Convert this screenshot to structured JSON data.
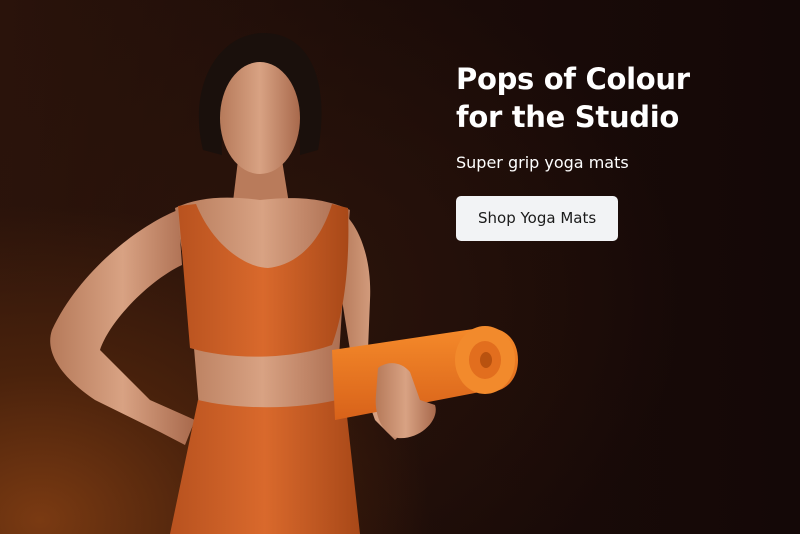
{
  "hero": {
    "headline_line1": "Pops of Colour",
    "headline_line2": "for the Studio",
    "subheadline": "Super grip yoga mats",
    "cta_label": "Shop Yoga Mats"
  },
  "colors": {
    "background": "#1c0c08",
    "accent_orange": "#d8662a",
    "mat_orange": "#f07a1e",
    "button_bg": "#f2f3f5",
    "button_text": "#1b1b1b",
    "headline_text": "#ffffff"
  },
  "image": {
    "subject": "woman-holding-yoga-mat"
  }
}
